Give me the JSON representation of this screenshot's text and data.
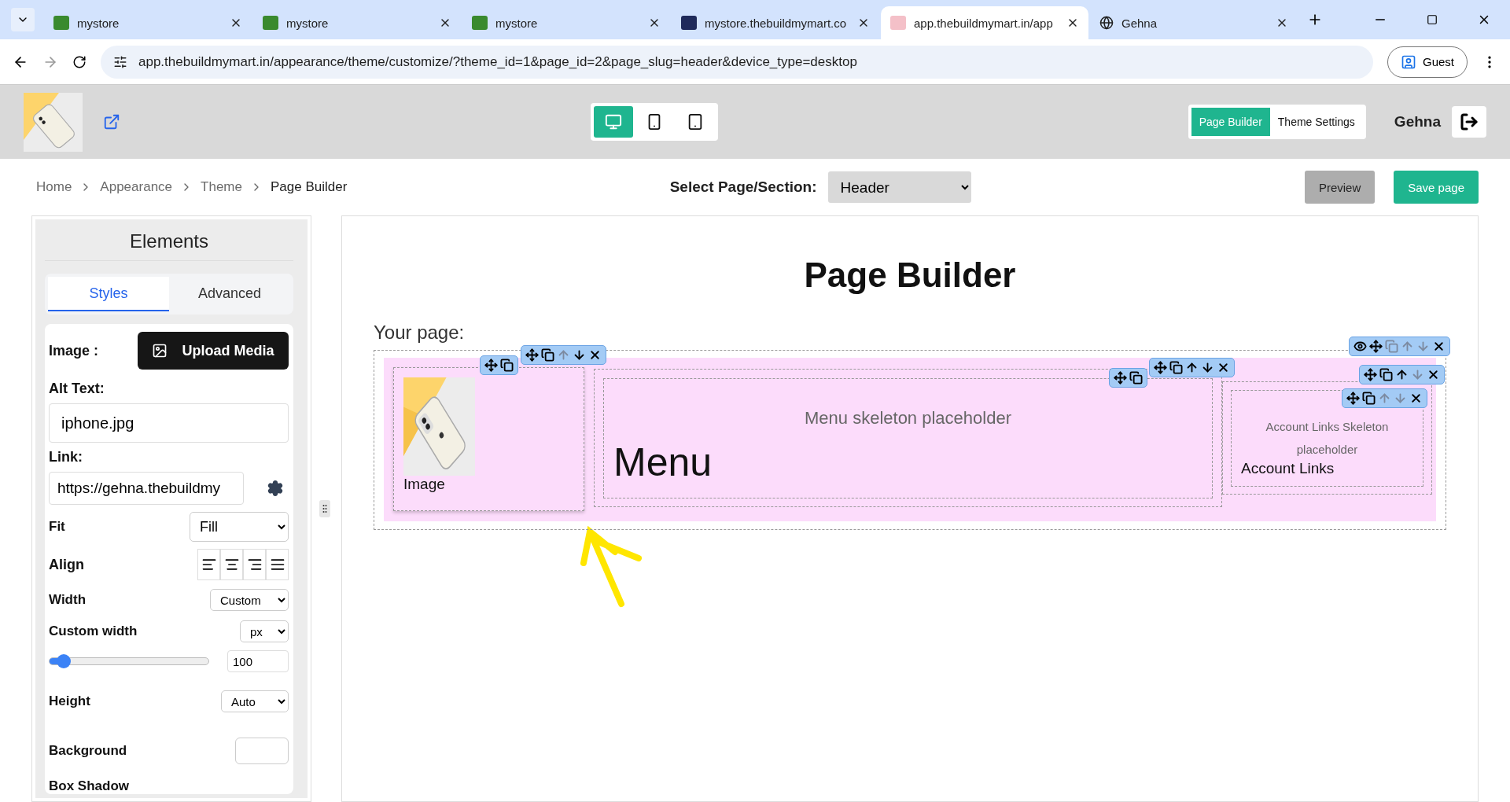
{
  "browser": {
    "tabs": [
      {
        "title": "mystore",
        "kind": "store",
        "selected": false
      },
      {
        "title": "mystore",
        "kind": "store",
        "selected": false
      },
      {
        "title": "mystore",
        "kind": "store",
        "selected": false
      },
      {
        "title": "mystore.thebuildmymart.co",
        "kind": "dark",
        "selected": false
      },
      {
        "title": "app.thebuildmymart.in/app",
        "kind": "app",
        "selected": true
      },
      {
        "title": "Gehna",
        "kind": "globe",
        "selected": false
      }
    ],
    "address": "app.thebuildmymart.in/appearance/theme/customize/?theme_id=1&page_id=2&page_slug=header&device_type=desktop",
    "profile": "Guest"
  },
  "header": {
    "devices": [
      {
        "kind": "desktop",
        "selected": true
      },
      {
        "kind": "phone",
        "selected": false
      },
      {
        "kind": "tablet",
        "selected": false
      }
    ],
    "modes": [
      {
        "label": "Page Builder",
        "selected": true
      },
      {
        "label": "Theme Settings",
        "selected": false
      }
    ],
    "user": "Gehna"
  },
  "breadcrumb": [
    "Home",
    "Appearance",
    "Theme",
    "Page Builder"
  ],
  "section_select": {
    "label": "Select Page/Section:",
    "value": "Header"
  },
  "actions": [
    {
      "label": "Preview",
      "kind": "secondary"
    },
    {
      "label": "Save page",
      "kind": "primary"
    }
  ],
  "panel": {
    "title": "Elements",
    "tabs": [
      {
        "label": "Styles",
        "selected": true
      },
      {
        "label": "Advanced",
        "selected": false
      }
    ],
    "image_label": "Image :",
    "upload": "Upload Media",
    "alt_label": "Alt Text:",
    "alt_value": "iphone.jpg",
    "link_label": "Link:",
    "link_value": "https://gehna.thebuildmy",
    "fit": {
      "label": "Fit",
      "value": "Fill"
    },
    "align_label": "Align",
    "align_options": [
      {
        "kind": "left"
      },
      {
        "kind": "center"
      },
      {
        "kind": "right"
      },
      {
        "kind": "justify"
      }
    ],
    "width": {
      "label": "Width",
      "value": "Custom"
    },
    "custom_width": {
      "label": "Custom width",
      "unit": "px",
      "value": "100"
    },
    "height": {
      "label": "Height",
      "value": "Auto"
    },
    "background_label": "Background",
    "box_shadow_label": "Box Shadow"
  },
  "canvas": {
    "title": "Page Builder",
    "your_page": "Your page:",
    "image_caption": "Image",
    "menu_placeholder": "Menu skeleton placeholder",
    "menu": "Menu",
    "account_placeholder": "Account Links Skeleton placeholder",
    "account": "Account Links",
    "toolbars": [
      {
        "icons": [
          {
            "kind": "move",
            "disabled": false
          },
          {
            "kind": "copy",
            "disabled": false
          }
        ]
      },
      {
        "icons": [
          {
            "kind": "move",
            "disabled": false
          },
          {
            "kind": "copy",
            "disabled": false
          },
          {
            "kind": "up",
            "disabled": true
          },
          {
            "kind": "down",
            "disabled": false
          },
          {
            "kind": "close",
            "disabled": false
          }
        ]
      },
      {
        "icons": [
          {
            "kind": "move",
            "disabled": false
          },
          {
            "kind": "copy",
            "disabled": false
          }
        ]
      },
      {
        "icons": [
          {
            "kind": "move",
            "disabled": false
          },
          {
            "kind": "copy",
            "disabled": false
          },
          {
            "kind": "up",
            "disabled": false
          },
          {
            "kind": "down",
            "disabled": false
          },
          {
            "kind": "close",
            "disabled": false
          }
        ]
      },
      {
        "icons": [
          {
            "kind": "eye",
            "disabled": false
          },
          {
            "kind": "move",
            "disabled": false
          },
          {
            "kind": "copy",
            "disabled": true
          },
          {
            "kind": "up",
            "disabled": true
          },
          {
            "kind": "down",
            "disabled": true
          },
          {
            "kind": "close",
            "disabled": false
          }
        ]
      },
      {
        "icons": [
          {
            "kind": "move",
            "disabled": false
          },
          {
            "kind": "copy",
            "disabled": false
          },
          {
            "kind": "up",
            "disabled": false
          },
          {
            "kind": "down",
            "disabled": true
          },
          {
            "kind": "close",
            "disabled": false
          }
        ]
      },
      {
        "icons": [
          {
            "kind": "move",
            "disabled": false
          },
          {
            "kind": "copy",
            "disabled": false
          },
          {
            "kind": "up",
            "disabled": true
          },
          {
            "kind": "down",
            "disabled": true
          },
          {
            "kind": "close",
            "disabled": false
          }
        ]
      }
    ]
  }
}
